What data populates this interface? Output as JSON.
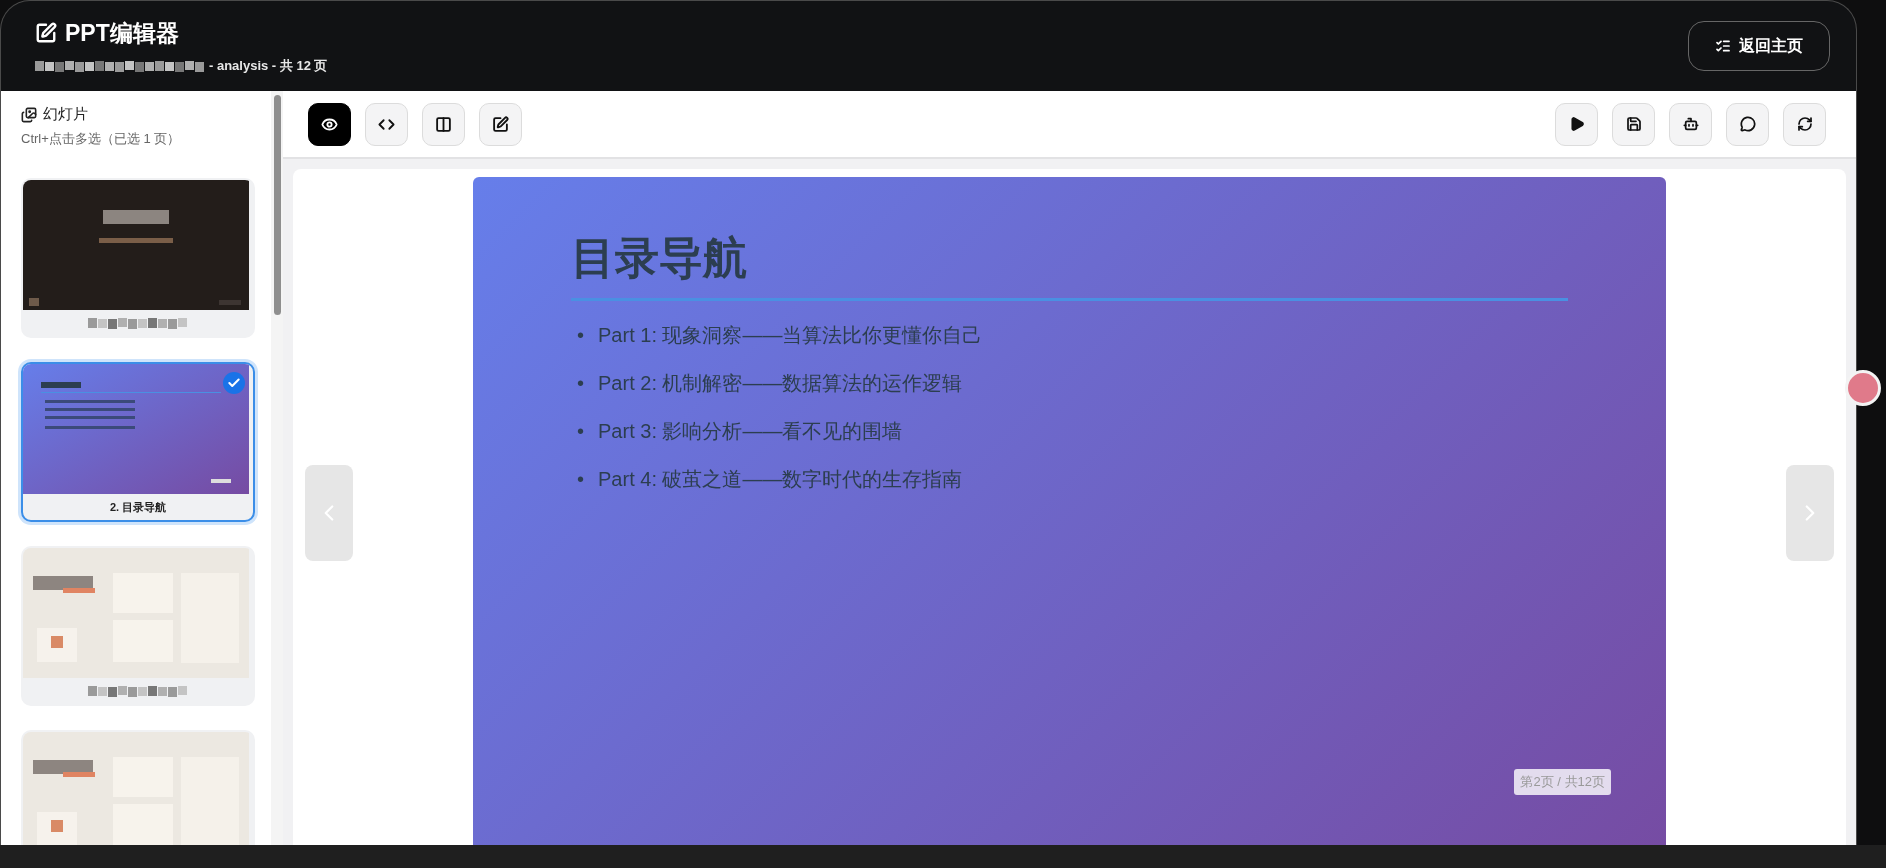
{
  "header": {
    "title": "PPT编辑器",
    "subtitle": "- analysis - 共 12 页",
    "back_button": "返回主页"
  },
  "sidebar": {
    "title": "幻灯片",
    "hint": "Ctrl+点击多选（已选 1 页）",
    "slides": [
      {
        "kind": "dark",
        "selected": false,
        "label_redacted": true
      },
      {
        "kind": "gradient",
        "selected": true,
        "label": "2. 目录导航"
      },
      {
        "kind": "cream",
        "selected": false,
        "label_redacted": true
      },
      {
        "kind": "cream",
        "selected": false
      }
    ]
  },
  "toolbar": {
    "left_tools": [
      {
        "kind": "preview",
        "selected": true
      },
      {
        "kind": "code",
        "selected": false
      },
      {
        "kind": "split",
        "selected": false
      },
      {
        "kind": "edit",
        "selected": false
      }
    ],
    "right_tools": [
      {
        "kind": "play"
      },
      {
        "kind": "save"
      },
      {
        "kind": "ai"
      },
      {
        "kind": "comment"
      },
      {
        "kind": "refresh"
      }
    ]
  },
  "slide": {
    "title": "目录导航",
    "items": [
      {
        "marker": "•",
        "text": "Part 1: 现象洞察——当算法比你更懂你自己"
      },
      {
        "marker": "•",
        "text": "Part 2: 机制解密——数据算法的运作逻辑"
      },
      {
        "marker": "•",
        "text": "Part 3: 影响分析——看不见的围墙"
      },
      {
        "marker": "•",
        "text": "Part 4: 破茧之道——数字时代的生存指南"
      }
    ],
    "page_label": "第2页 / 共12页"
  }
}
